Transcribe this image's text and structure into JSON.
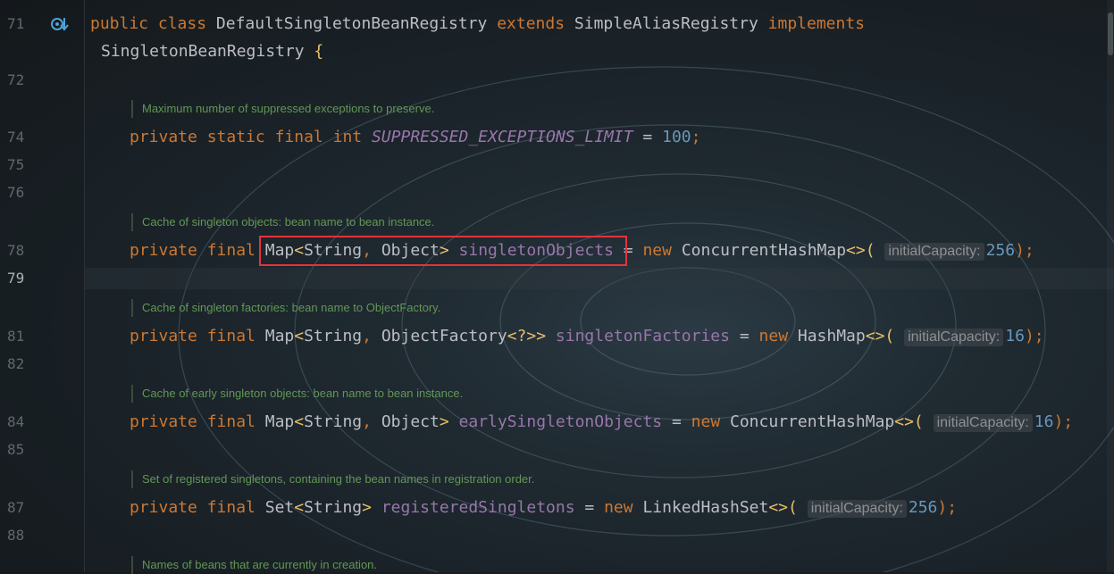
{
  "editor": {
    "line_numbers": [
      "71",
      "72",
      "74",
      "75",
      "76",
      "78",
      "79",
      "81",
      "82",
      "84",
      "85",
      "87",
      "88"
    ],
    "current_line": "79",
    "class_decl": {
      "kw_public": "public",
      "kw_class": "class",
      "class_name": "DefaultSingletonBeanRegistry",
      "kw_extends": "extends",
      "super_name": "SimpleAliasRegistry",
      "kw_implements": "implements",
      "iface_name": "SingletonBeanRegistry",
      "brace": "{"
    },
    "docs": {
      "d1": "Maximum number of suppressed exceptions to preserve.",
      "d2": "Cache of singleton objects: bean name to bean instance.",
      "d3": "Cache of singleton factories: bean name to ObjectFactory.",
      "d4": "Cache of early singleton objects: bean name to bean instance.",
      "d5": "Set of registered singletons, containing the bean names in registration order.",
      "d6": "Names of beans that are currently in creation."
    },
    "fields": {
      "f1": {
        "mod1": "private",
        "mod2": "static",
        "mod3": "final",
        "type": "int",
        "name": "SUPPRESSED_EXCEPTIONS_LIMIT",
        "eq": "=",
        "value": "100",
        "semi": ";"
      },
      "f2": {
        "mod1": "private",
        "mod2": "final",
        "type": "Map",
        "lt": "<",
        "t1": "String",
        "comma": ",",
        "t2": "Object",
        "gt": ">",
        "name": "singletonObjects",
        "eq": "=",
        "kw_new": "new",
        "ctor": "ConcurrentHashMap",
        "diamond": "<>(",
        "hint": "initialCapacity:",
        "arg": "256",
        "end": ");"
      },
      "f3": {
        "mod1": "private",
        "mod2": "final",
        "type": "Map",
        "lt": "<",
        "t1": "String",
        "comma": ",",
        "t2": "ObjectFactory",
        "wild": "<?>>",
        "name": "singletonFactories",
        "eq": "=",
        "kw_new": "new",
        "ctor": "HashMap",
        "diamond": "<>(",
        "hint": "initialCapacity:",
        "arg": "16",
        "end": ");"
      },
      "f4": {
        "mod1": "private",
        "mod2": "final",
        "type": "Map",
        "lt": "<",
        "t1": "String",
        "comma": ",",
        "t2": "Object",
        "gt": ">",
        "name": "earlySingletonObjects",
        "eq": "=",
        "kw_new": "new",
        "ctor": "ConcurrentHashMap",
        "diamond": "<>(",
        "hint": "initialCapacity:",
        "arg": "16",
        "end": ");"
      },
      "f5": {
        "mod1": "private",
        "mod2": "final",
        "type": "Set",
        "lt": "<",
        "t1": "String",
        "gt": ">",
        "name": "registeredSingletons",
        "eq": "=",
        "kw_new": "new",
        "ctor": "LinkedHashSet",
        "diamond": "<>(",
        "hint": "initialCapacity:",
        "arg": "256",
        "end": ");"
      }
    },
    "colors": {
      "keyword": "#cc7832",
      "field": "#9876aa",
      "number": "#6897bb",
      "doc": "#629755",
      "highlight": "#e5323a"
    }
  }
}
